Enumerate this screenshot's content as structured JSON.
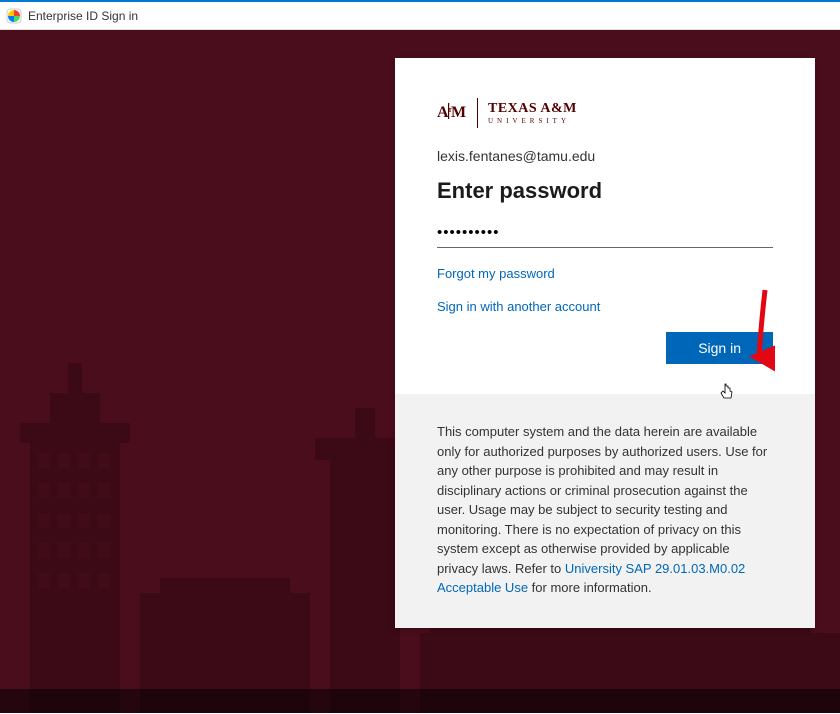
{
  "window": {
    "title": "Enterprise ID Sign in"
  },
  "logo": {
    "mark": "A|M",
    "main": "TEXAS A&M",
    "sub": "UNIVERSITY"
  },
  "login": {
    "email": "lexis.fentanes@tamu.edu",
    "heading": "Enter password",
    "password_value": "••••••••••",
    "forgot_link": "Forgot my password",
    "other_account_link": "Sign in with another account",
    "signin_button": "Sign in"
  },
  "disclaimer": {
    "text_before": "This computer system and the data herein are available only for authorized purposes by authorized users. Use for any other purpose is prohibited and may result in disciplinary actions or criminal prosecution against the user. Usage may be subject to security testing and monitoring. There is no expectation of privacy on this system except as otherwise provided by applicable privacy laws. Refer to ",
    "link_text": "University SAP 29.01.03.M0.02 Acceptable Use",
    "text_after": " for more information."
  }
}
